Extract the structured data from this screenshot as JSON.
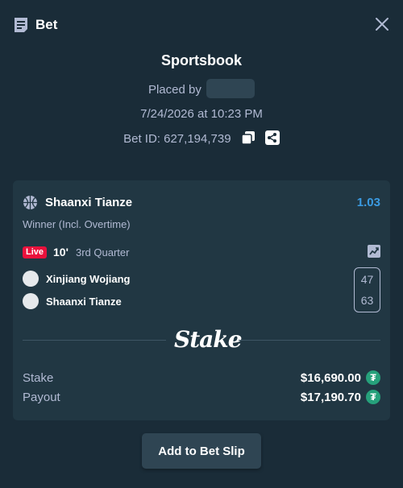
{
  "header": {
    "title": "Bet",
    "icon": "receipt-icon",
    "close_icon": "close-icon"
  },
  "summary": {
    "sportsbook": "Sportsbook",
    "placed_by": "Placed by",
    "date": "7/24/2026 at 10:23 PM",
    "bet_id": "Bet ID: 627,194,739"
  },
  "bet": {
    "team": "Shaanxi Tianze",
    "odds": "1.03",
    "market": "Winner (Incl. Overtime)",
    "live_label": "Live",
    "live_minute": "10'",
    "live_period": "3rd Quarter",
    "teams": [
      {
        "name": "Xinjiang Wojiang",
        "score": "47"
      },
      {
        "name": "Shaanxi Tianze",
        "score": "63"
      }
    ],
    "brand": "Stake",
    "stake_label": "Stake",
    "stake_value": "$16,690.00",
    "payout_label": "Payout",
    "payout_value": "$17,190.70",
    "currency_icon": "tether-icon"
  },
  "actions": {
    "add_to_bet_slip": "Add to Bet Slip"
  },
  "colors": {
    "background": "#1a2c38",
    "card": "#213743",
    "odds": "#3b9be3",
    "live": "#e9113c",
    "currency": "#26a17b",
    "muted_text": "#b1bad3"
  }
}
